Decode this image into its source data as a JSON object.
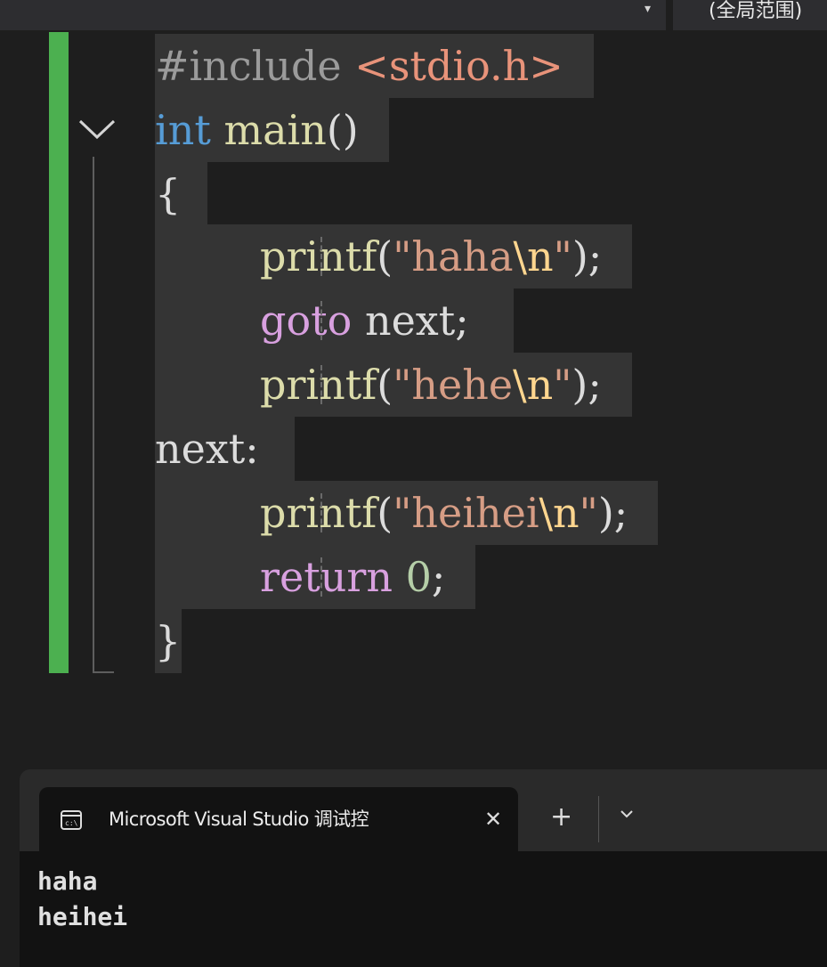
{
  "scope_bar": {
    "dropdown_arrow": "▾",
    "scope_label": "(全局范围)"
  },
  "editor": {
    "fold_icon": "chevron-down-icon",
    "colors": {
      "change_bar": "#4cb050",
      "keyword": "#569cd6",
      "function": "#dcdcaa",
      "control": "#d8a0df",
      "string": "#d69d85",
      "escape": "#ffd68f",
      "number": "#b5cea8",
      "preprocessor": "#9b9b9b"
    },
    "lines": {
      "l1": {
        "directive": "#include",
        "space": " ",
        "header": "<stdio.h>"
      },
      "l2": {
        "type": "int",
        "space": " ",
        "name": "main",
        "parens": "()"
      },
      "l3": {
        "text": "{"
      },
      "l4": {
        "fn": "printf",
        "open": "(",
        "str": "\"haha",
        "esc": "\\n",
        "strend": "\"",
        "close": ");"
      },
      "l5": {
        "kw": "goto",
        "rest": " next;"
      },
      "l6": {
        "fn": "printf",
        "open": "(",
        "str": "\"hehe",
        "esc": "\\n",
        "strend": "\"",
        "close": ");"
      },
      "l7": {
        "label": "next:"
      },
      "l8": {
        "fn": "printf",
        "open": "(",
        "str": "\"heihei",
        "esc": "\\n",
        "strend": "\"",
        "close": ");"
      },
      "l9": {
        "kw": "return",
        "space": " ",
        "num": "0",
        "semi": ";"
      },
      "l10": {
        "text": "}"
      }
    }
  },
  "terminal": {
    "tab_icon": "console-icon",
    "tab_title": "Microsoft Visual Studio 调试控",
    "close_label": "✕",
    "new_tab_label": "+",
    "dropdown_icon": "chevron-down-icon",
    "output": [
      "haha",
      "heihei"
    ]
  }
}
